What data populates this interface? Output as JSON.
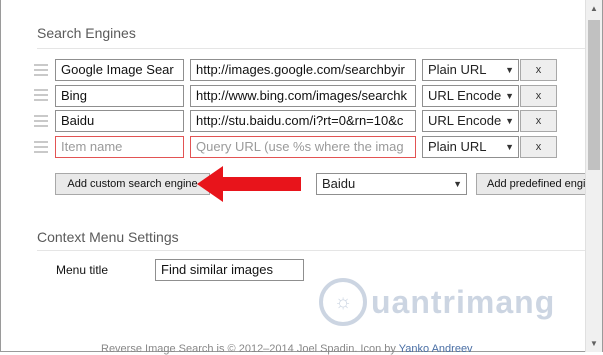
{
  "search_engines": {
    "title": "Search Engines",
    "rows": [
      {
        "name": "Google Image Sear",
        "url": "http://images.google.com/searchbyir",
        "encoding": "Plain URL",
        "remove_label": "x",
        "is_new": false
      },
      {
        "name": "Bing",
        "url": "http://www.bing.com/images/searchk",
        "encoding": "URL Encode",
        "remove_label": "x",
        "is_new": false
      },
      {
        "name": "Baidu",
        "url": "http://stu.baidu.com/i?rt=0&rn=10&c",
        "encoding": "URL Encode",
        "remove_label": "x",
        "is_new": false
      },
      {
        "name_placeholder": "Item name",
        "url_placeholder": "Query URL (use %s where the imag",
        "encoding": "Plain URL",
        "remove_label": "x",
        "is_new": true
      }
    ],
    "add_custom_label": "Add custom search engine",
    "predefined_selected": "Baidu",
    "add_predefined_label": "Add predefined engin"
  },
  "context_menu": {
    "title": "Context Menu Settings",
    "menu_title_label": "Menu title",
    "menu_title_value": "Find similar images"
  },
  "footer": {
    "text": "Reverse Image Search is © 2012–2014 Joel Spadin. Icon by ",
    "link": "Yanko Andreev"
  },
  "watermark": {
    "text": "uantrimang"
  },
  "colors": {
    "arrow": "#e8141b",
    "invalid_border": "#e25353"
  },
  "icons": {
    "handle": "drag-handle-icon",
    "remove": "x-icon",
    "dropdown": "chevron-down-icon",
    "arrow": "red-arrow-left"
  }
}
